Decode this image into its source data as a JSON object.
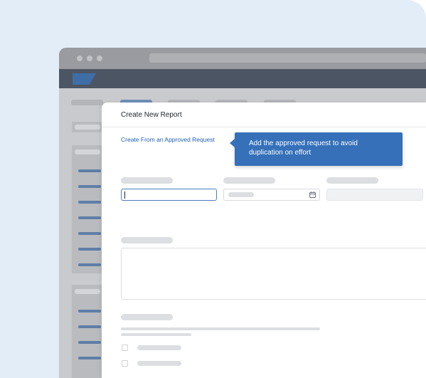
{
  "modal": {
    "title": "Create New Report",
    "create_link": "Create From an Approved Request"
  },
  "tooltip": {
    "text": "Add the approved request to avoid duplication on effort"
  },
  "icons": {
    "calendar": "calendar-icon",
    "logo": "brand-logo"
  },
  "colors": {
    "accent": "#3570b9",
    "link": "#1f5fae",
    "app_bar": "#4c5563",
    "focus_border": "#4a7dc0",
    "background_panel": "#e2edf8"
  }
}
